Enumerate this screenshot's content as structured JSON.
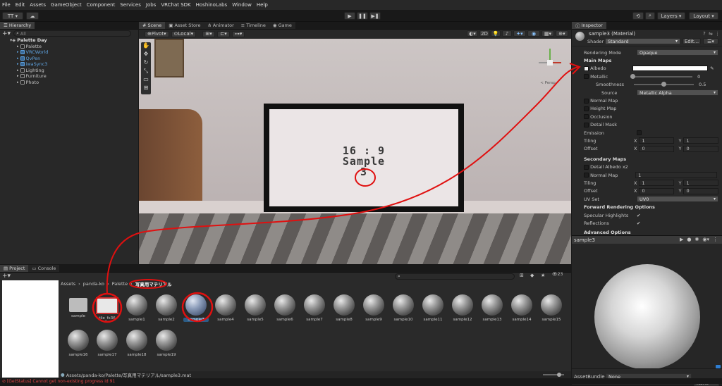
{
  "menu": [
    "File",
    "Edit",
    "Assets",
    "GameObject",
    "Component",
    "Services",
    "Jobs",
    "VRChat SDK",
    "HoshinoLabs",
    "Window",
    "Help"
  ],
  "toolbar": {
    "account": "TT",
    "layers": "Layers",
    "layout": "Layout"
  },
  "hierarchy": {
    "tab": "Hierarchy",
    "search": "All",
    "scene": "Palette Day",
    "items": [
      "Palette",
      "VRCWorld",
      "QvPen",
      "iwaSync3",
      "Lighting",
      "Furniture",
      "Photo"
    ]
  },
  "scene_tabs": {
    "scene": "Scene",
    "asset_store": "Asset Store",
    "animator": "Animator",
    "timeline": "Timeline",
    "game": "Game"
  },
  "scene_toolbar": {
    "pivot": "Pivot",
    "local": "Local",
    "gizmo_size": "2D",
    "persp": "< Persp"
  },
  "scene_view": {
    "line1": "16 : 9",
    "line2": "Sample",
    "line3": "3"
  },
  "inspector": {
    "tab": "Inspector",
    "material_name": "sample3 (Material)",
    "shader_label": "Shader",
    "shader": "Standard",
    "edit": "Edit...",
    "rendering_mode_label": "Rendering Mode",
    "rendering_mode": "Opaque",
    "main_maps": "Main Maps",
    "albedo": "Albedo",
    "metallic": "Metallic",
    "metallic_val": "0",
    "smoothness": "Smoothness",
    "smoothness_val": "0.5",
    "source": "Source",
    "source_val": "Metallic Alpha",
    "normal_map": "Normal Map",
    "height_map": "Height Map",
    "occlusion": "Occlusion",
    "detail_mask": "Detail Mask",
    "emission": "Emission",
    "tiling": "Tiling",
    "offset": "Offset",
    "x": "X",
    "y": "Y",
    "tiling_x": "1",
    "tiling_y": "1",
    "offset_x": "0",
    "offset_y": "0",
    "secondary_maps": "Secondary Maps",
    "detail_albedo": "Detail Albedo x2",
    "normal_map2": "Normal Map",
    "normal_scale": "1",
    "tiling2_x": "1",
    "tiling2_y": "1",
    "offset2_x": "0",
    "offset2_y": "0",
    "uv_set": "UV Set",
    "uv_val": "UV0",
    "forward_opts": "Forward Rendering Options",
    "specular": "Specular Highlights",
    "reflections": "Reflections",
    "advanced": "Advanced Options",
    "preview_name": "sample3",
    "assetbundle_label": "AssetBundle",
    "assetbundle": "None",
    "variant": "None"
  },
  "project": {
    "tab_project": "Project",
    "tab_console": "Console",
    "breadcrumb": [
      "Assets",
      "panda-ko",
      "Palette",
      "写真用マテリアル"
    ],
    "count": "23",
    "path": "Assets/panda-ko/Palette/写真用マテリアル/sample3.mat",
    "row1": [
      "sample",
      "tile_fx36",
      "sample1",
      "sample2",
      "sample3",
      "sample4",
      "sample5",
      "sample6",
      "sample7",
      "sample8",
      "sample9",
      "sample10",
      "sample11",
      "sample12",
      "sample13",
      "sample14",
      "sample15"
    ],
    "row2": [
      "sample16",
      "sample17",
      "sample18",
      "sample19"
    ]
  },
  "status": {
    "message": "[GetStatus] Cannot get non-existing progress id 91"
  },
  "colors": {
    "accent": "#2c5d87",
    "annotation": "#e01010",
    "warning": "#e04040"
  }
}
